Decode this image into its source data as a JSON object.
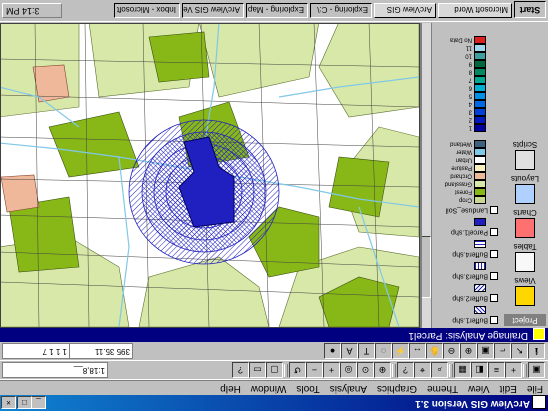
{
  "app": {
    "title": "ArcView GIS Version 3.1",
    "window_controls": [
      "_",
      "□",
      "×"
    ]
  },
  "menu": [
    "File",
    "Edit",
    "View",
    "Theme",
    "Graphics",
    "Analysis",
    "Tools",
    "Window",
    "Help"
  ],
  "readouts": {
    "scale": "1:18,8__",
    "coord_x": "395 35.11",
    "coord_y": "1 1 1 7"
  },
  "view_window": {
    "title": "Drainage Analysis: Parcel1"
  },
  "doc_panel": {
    "title": "Project",
    "items": [
      "Views",
      "Tables",
      "Charts",
      "Layouts",
      "Scripts"
    ]
  },
  "toc": {
    "themes": [
      {
        "name": "Buffer1.shp"
      },
      {
        "name": "Buffer2.shp"
      },
      {
        "name": "Buffer3.shp"
      },
      {
        "name": "Buffer4.shp"
      },
      {
        "name": "Parcel1.shp"
      },
      {
        "name": "Landuse_Soil"
      }
    ],
    "landuse_legend": [
      "Crop",
      "Forest",
      "Grassland",
      "Orchard",
      "Pasture",
      "Urban",
      "Water",
      "Wetland"
    ],
    "elev_legend": [
      "1",
      "2",
      "3",
      "4",
      "5",
      "6",
      "7",
      "8",
      "9",
      "10",
      "11",
      "No Data"
    ]
  },
  "taskbar": {
    "start": "Start",
    "tasks": [
      "Microsoft Word",
      "ArcView GIS",
      "Exploring - C:\\",
      "Exploring - Map",
      "ArcView GIS Ver",
      "Inbox - Microsoft"
    ],
    "clock": "3:14 PM"
  },
  "colors": {
    "title_bar": "#000080",
    "light_green": "#d8e8a8",
    "dark_green": "#88b818",
    "salmon": "#f0b89a",
    "buffer_blue": "#2020c0",
    "stream_blue": "#80c8e8"
  }
}
